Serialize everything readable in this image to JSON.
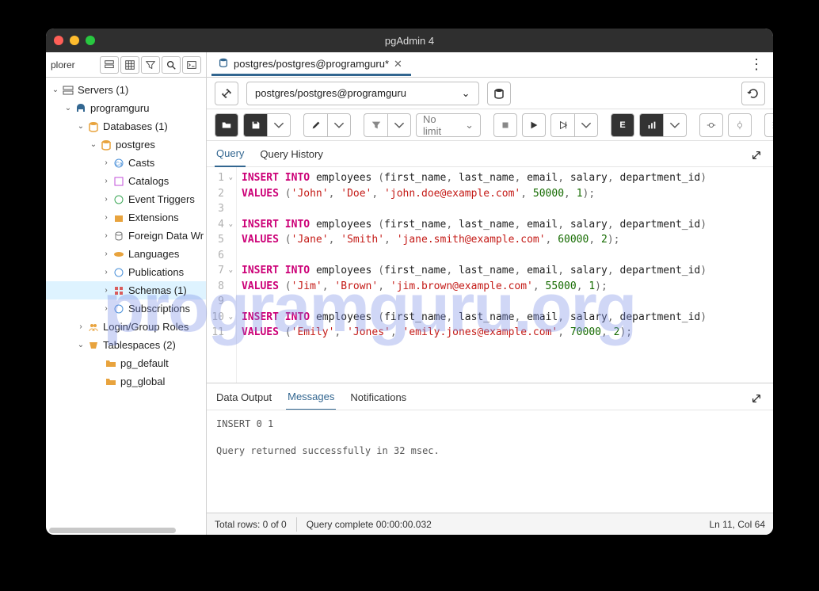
{
  "app_title": "pgAdmin 4",
  "sidebar": {
    "label": "plorer",
    "servers": "Servers (1)",
    "server_name": "programguru",
    "databases": "Databases (1)",
    "db_name": "postgres",
    "nodes": {
      "casts": "Casts",
      "catalogs": "Catalogs",
      "event_triggers": "Event Triggers",
      "extensions": "Extensions",
      "fdw": "Foreign Data Wr",
      "languages": "Languages",
      "publications": "Publications",
      "schemas": "Schemas (1)",
      "subscriptions": "Subscriptions"
    },
    "login_roles": "Login/Group Roles",
    "tablespaces": "Tablespaces (2)",
    "ts1": "pg_default",
    "ts2": "pg_global"
  },
  "tab": {
    "title": "postgres/postgres@programguru*"
  },
  "connection": "postgres/postgres@programguru",
  "nolimit": "No limit",
  "query_tabs": {
    "query": "Query",
    "history": "Query History"
  },
  "output_tabs": {
    "data": "Data Output",
    "messages": "Messages",
    "notifications": "Notifications"
  },
  "messages": {
    "line1": "INSERT 0 1",
    "line2": "Query returned successfully in 32 msec."
  },
  "status": {
    "rows": "Total rows: 0 of 0",
    "complete": "Query complete 00:00:00.032",
    "pos": "Ln 11, Col 64"
  },
  "sql": [
    {
      "n": 1,
      "fold": true,
      "t": [
        [
          "kw",
          "INSERT"
        ],
        [
          "sp",
          " "
        ],
        [
          "kw",
          "INTO"
        ],
        [
          "sp",
          " "
        ],
        [
          "id",
          "employees"
        ],
        [
          "sp",
          " "
        ],
        [
          "pn",
          "("
        ],
        [
          "id",
          "first_name"
        ],
        [
          "pn",
          ","
        ],
        [
          "sp",
          " "
        ],
        [
          "id",
          "last_name"
        ],
        [
          "pn",
          ","
        ],
        [
          "sp",
          " "
        ],
        [
          "id",
          "email"
        ],
        [
          "pn",
          ","
        ],
        [
          "sp",
          " "
        ],
        [
          "id",
          "salary"
        ],
        [
          "pn",
          ","
        ],
        [
          "sp",
          " "
        ],
        [
          "id",
          "department_id"
        ],
        [
          "pn",
          ")"
        ]
      ]
    },
    {
      "n": 2,
      "t": [
        [
          "kw",
          "VALUES"
        ],
        [
          "sp",
          " "
        ],
        [
          "pn",
          "("
        ],
        [
          "str",
          "'John'"
        ],
        [
          "pn",
          ","
        ],
        [
          "sp",
          " "
        ],
        [
          "str",
          "'Doe'"
        ],
        [
          "pn",
          ","
        ],
        [
          "sp",
          " "
        ],
        [
          "str",
          "'john.doe@example.com'"
        ],
        [
          "pn",
          ","
        ],
        [
          "sp",
          " "
        ],
        [
          "num",
          "50000"
        ],
        [
          "pn",
          ","
        ],
        [
          "sp",
          " "
        ],
        [
          "num",
          "1"
        ],
        [
          "pn",
          ");"
        ]
      ]
    },
    {
      "n": 3,
      "t": []
    },
    {
      "n": 4,
      "fold": true,
      "t": [
        [
          "kw",
          "INSERT"
        ],
        [
          "sp",
          " "
        ],
        [
          "kw",
          "INTO"
        ],
        [
          "sp",
          " "
        ],
        [
          "id",
          "employees"
        ],
        [
          "sp",
          " "
        ],
        [
          "pn",
          "("
        ],
        [
          "id",
          "first_name"
        ],
        [
          "pn",
          ","
        ],
        [
          "sp",
          " "
        ],
        [
          "id",
          "last_name"
        ],
        [
          "pn",
          ","
        ],
        [
          "sp",
          " "
        ],
        [
          "id",
          "email"
        ],
        [
          "pn",
          ","
        ],
        [
          "sp",
          " "
        ],
        [
          "id",
          "salary"
        ],
        [
          "pn",
          ","
        ],
        [
          "sp",
          " "
        ],
        [
          "id",
          "department_id"
        ],
        [
          "pn",
          ")"
        ]
      ]
    },
    {
      "n": 5,
      "t": [
        [
          "kw",
          "VALUES"
        ],
        [
          "sp",
          " "
        ],
        [
          "pn",
          "("
        ],
        [
          "str",
          "'Jane'"
        ],
        [
          "pn",
          ","
        ],
        [
          "sp",
          " "
        ],
        [
          "str",
          "'Smith'"
        ],
        [
          "pn",
          ","
        ],
        [
          "sp",
          " "
        ],
        [
          "str",
          "'jane.smith@example.com'"
        ],
        [
          "pn",
          ","
        ],
        [
          "sp",
          " "
        ],
        [
          "num",
          "60000"
        ],
        [
          "pn",
          ","
        ],
        [
          "sp",
          " "
        ],
        [
          "num",
          "2"
        ],
        [
          "pn",
          ");"
        ]
      ]
    },
    {
      "n": 6,
      "t": []
    },
    {
      "n": 7,
      "fold": true,
      "t": [
        [
          "kw",
          "INSERT"
        ],
        [
          "sp",
          " "
        ],
        [
          "kw",
          "INTO"
        ],
        [
          "sp",
          " "
        ],
        [
          "id",
          "employees"
        ],
        [
          "sp",
          " "
        ],
        [
          "pn",
          "("
        ],
        [
          "id",
          "first_name"
        ],
        [
          "pn",
          ","
        ],
        [
          "sp",
          " "
        ],
        [
          "id",
          "last_name"
        ],
        [
          "pn",
          ","
        ],
        [
          "sp",
          " "
        ],
        [
          "id",
          "email"
        ],
        [
          "pn",
          ","
        ],
        [
          "sp",
          " "
        ],
        [
          "id",
          "salary"
        ],
        [
          "pn",
          ","
        ],
        [
          "sp",
          " "
        ],
        [
          "id",
          "department_id"
        ],
        [
          "pn",
          ")"
        ]
      ]
    },
    {
      "n": 8,
      "t": [
        [
          "kw",
          "VALUES"
        ],
        [
          "sp",
          " "
        ],
        [
          "pn",
          "("
        ],
        [
          "str",
          "'Jim'"
        ],
        [
          "pn",
          ","
        ],
        [
          "sp",
          " "
        ],
        [
          "str",
          "'Brown'"
        ],
        [
          "pn",
          ","
        ],
        [
          "sp",
          " "
        ],
        [
          "str",
          "'jim.brown@example.com'"
        ],
        [
          "pn",
          ","
        ],
        [
          "sp",
          " "
        ],
        [
          "num",
          "55000"
        ],
        [
          "pn",
          ","
        ],
        [
          "sp",
          " "
        ],
        [
          "num",
          "1"
        ],
        [
          "pn",
          ");"
        ]
      ]
    },
    {
      "n": 9,
      "t": []
    },
    {
      "n": 10,
      "fold": true,
      "t": [
        [
          "kw",
          "INSERT"
        ],
        [
          "sp",
          " "
        ],
        [
          "kw",
          "INTO"
        ],
        [
          "sp",
          " "
        ],
        [
          "id",
          "employees"
        ],
        [
          "sp",
          " "
        ],
        [
          "pn",
          "("
        ],
        [
          "id",
          "first_name"
        ],
        [
          "pn",
          ","
        ],
        [
          "sp",
          " "
        ],
        [
          "id",
          "last_name"
        ],
        [
          "pn",
          ","
        ],
        [
          "sp",
          " "
        ],
        [
          "id",
          "email"
        ],
        [
          "pn",
          ","
        ],
        [
          "sp",
          " "
        ],
        [
          "id",
          "salary"
        ],
        [
          "pn",
          ","
        ],
        [
          "sp",
          " "
        ],
        [
          "id",
          "department_id"
        ],
        [
          "pn",
          ")"
        ]
      ]
    },
    {
      "n": 11,
      "t": [
        [
          "kw",
          "VALUES"
        ],
        [
          "sp",
          " "
        ],
        [
          "pn",
          "("
        ],
        [
          "str",
          "'Emily'"
        ],
        [
          "pn",
          ","
        ],
        [
          "sp",
          " "
        ],
        [
          "str",
          "'Jones'"
        ],
        [
          "pn",
          ","
        ],
        [
          "sp",
          " "
        ],
        [
          "str",
          "'emily.jones@example.com'"
        ],
        [
          "pn",
          ","
        ],
        [
          "sp",
          " "
        ],
        [
          "num",
          "70000"
        ],
        [
          "pn",
          ","
        ],
        [
          "sp",
          " "
        ],
        [
          "num",
          "2"
        ],
        [
          "pn",
          ");"
        ]
      ]
    }
  ],
  "watermark": "programguru.org"
}
